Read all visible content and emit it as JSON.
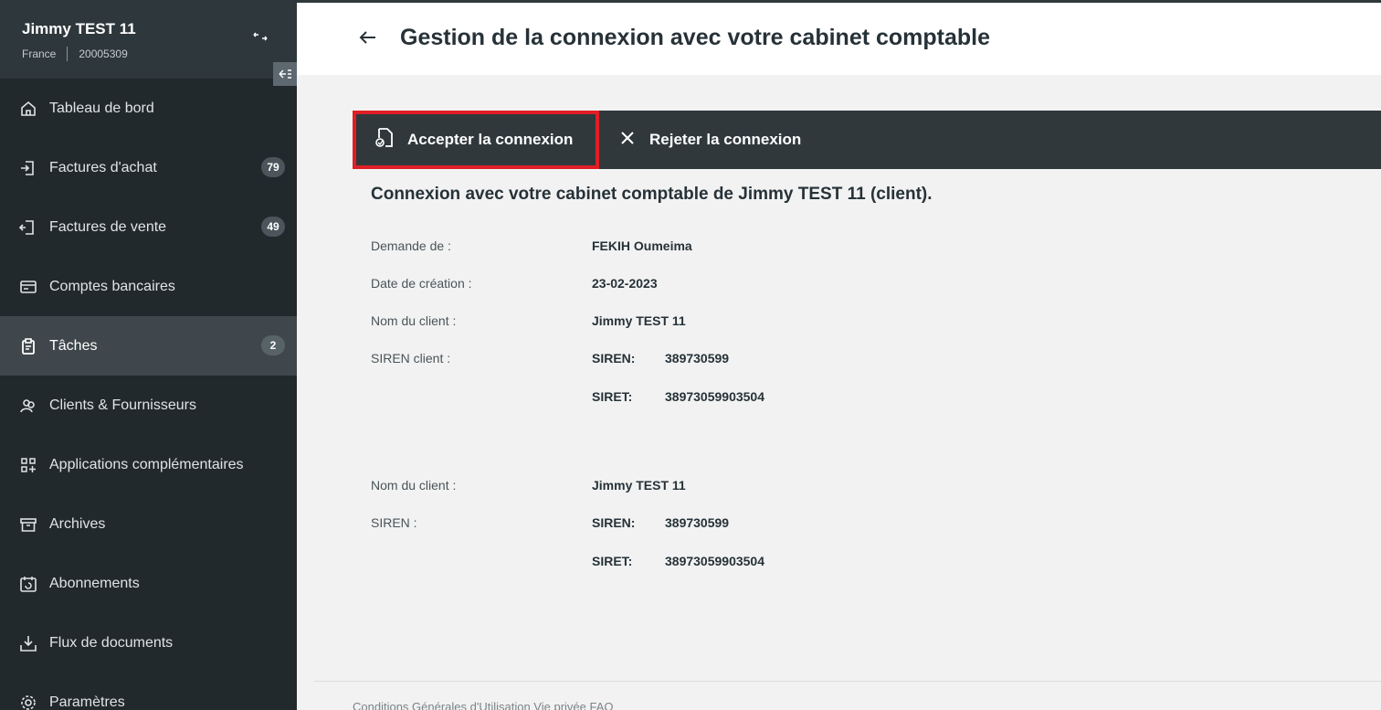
{
  "sidebar": {
    "company": "Jimmy TEST 11",
    "country": "France",
    "account_id": "20005309",
    "items": [
      {
        "label": "Tableau de bord",
        "badge": ""
      },
      {
        "label": "Factures d'achat",
        "badge": "79"
      },
      {
        "label": "Factures de vente",
        "badge": "49"
      },
      {
        "label": "Comptes bancaires",
        "badge": ""
      },
      {
        "label": "Tâches",
        "badge": "2"
      },
      {
        "label": "Clients & Fournisseurs",
        "badge": ""
      },
      {
        "label": "Applications complémentaires",
        "badge": ""
      },
      {
        "label": "Archives",
        "badge": ""
      },
      {
        "label": "Abonnements",
        "badge": ""
      },
      {
        "label": "Flux de documents",
        "badge": ""
      },
      {
        "label": "Paramètres",
        "badge": ""
      }
    ],
    "active_item": "Tâches"
  },
  "header": {
    "title": "Gestion de la connexion avec votre cabinet comptable"
  },
  "actions": {
    "accept_label": "Accepter la connexion",
    "reject_label": "Rejeter la connexion"
  },
  "content": {
    "title": "Connexion avec votre cabinet comptable de Jimmy TEST 11 (client).",
    "request_from_label": "Demande de :",
    "request_from_value": "FEKIH Oumeima",
    "creation_date_label": "Date de création :",
    "creation_date_value": "23-02-2023",
    "block1": {
      "client_name_label": "Nom du client :",
      "client_name_value": "Jimmy TEST 11",
      "siren_label": "SIREN client :",
      "siren_key": "SIREN:",
      "siren_value": "389730599",
      "siret_key": "SIRET:",
      "siret_value": "38973059903504"
    },
    "block2": {
      "client_name_label": "Nom du client :",
      "client_name_value": "Jimmy TEST 11",
      "siren_label": "SIREN :",
      "siren_key": "SIREN:",
      "siren_value": "389730599",
      "siret_key": "SIRET:",
      "siret_value": "38973059903504"
    }
  },
  "footer": {
    "text": "Conditions Générales d'Utilisation     Vie privée     FAQ"
  },
  "colors": {
    "sidebar_bg": "#22292d",
    "action_bar_bg": "#30383c",
    "highlight": "#e01e26"
  }
}
